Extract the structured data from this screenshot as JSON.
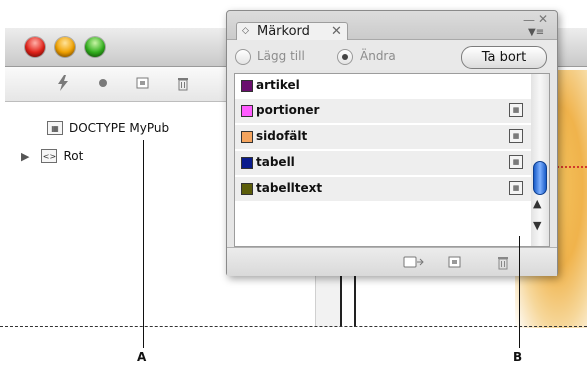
{
  "back_window": {
    "toolbar_icons": [
      "lightning-icon",
      "dot-icon",
      "new-element-icon",
      "trash-icon"
    ],
    "tree": {
      "doctype_badge_icon": "tag-icon",
      "doctype_label": "DOCTYPE MyPub",
      "root_icon": "element-icon",
      "root_label": "Rot"
    }
  },
  "tags_panel": {
    "tab_label": "Märkord",
    "tab_close": "✕",
    "radio_add_label": "Lägg till",
    "radio_change_label": "Ändra",
    "remove_button_label": "Ta bort",
    "tags": [
      {
        "name": "artikel",
        "color": "#6a0f6e",
        "badge": false
      },
      {
        "name": "portioner",
        "color": "#ff5cff",
        "badge": true
      },
      {
        "name": "sidofält",
        "color": "#f4a45e",
        "badge": true
      },
      {
        "name": "tabell",
        "color": "#0a1b8c",
        "badge": true
      },
      {
        "name": "tabelltext",
        "color": "#5b5d0a",
        "badge": true
      }
    ],
    "footer_icons": [
      "map-tags-icon",
      "new-tag-icon",
      "delete-tag-icon"
    ]
  },
  "callouts": {
    "a": "A",
    "b": "B"
  }
}
